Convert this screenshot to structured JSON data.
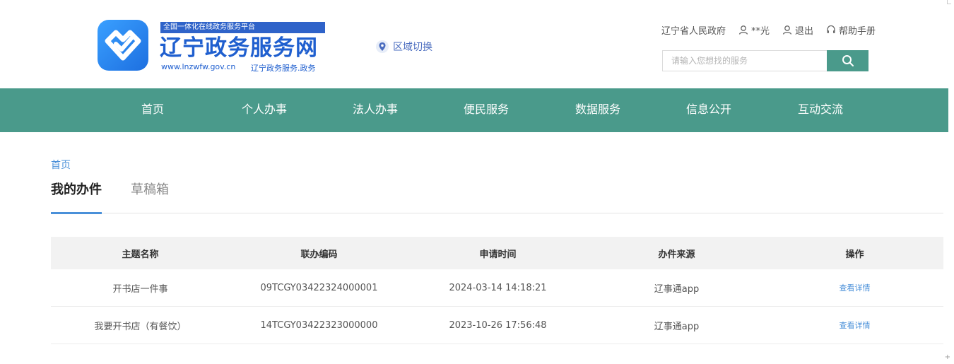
{
  "header": {
    "tagline": "全国一体化在线政务服务平台",
    "title": "辽宁政务服务网",
    "url": "www.lnzwfw.gov.cn",
    "subtitle": "辽宁政务服务.政务",
    "region_label": "区域切换",
    "links": {
      "gov": "辽宁省人民政府",
      "user": "**光",
      "logout": "退出",
      "help": "帮助手册"
    },
    "search_placeholder": "请输入您想找的服务"
  },
  "nav": {
    "items": [
      "首页",
      "个人办事",
      "法人办事",
      "便民服务",
      "数据服务",
      "信息公开",
      "互动交流"
    ]
  },
  "breadcrumb": "首页",
  "tabs": {
    "active": "我的办件",
    "inactive": "草稿箱"
  },
  "table": {
    "headers": [
      "主题名称",
      "联办编码",
      "申请时间",
      "办件来源",
      "操作"
    ],
    "rows": [
      [
        "开书店一件事",
        "09TCGY03422324000001",
        "2024-03-14 14:18:21",
        "辽事通app",
        "查看详情"
      ],
      [
        "我要开书店（有餐饮）",
        "14TCGY03422323000000",
        "2023-10-26 17:56:48",
        "辽事通app",
        "查看详情"
      ]
    ]
  },
  "colors": {
    "nav_bg": "#4a9a8b",
    "brand_blue": "#1f5fcf",
    "link_blue": "#4a90d9"
  }
}
